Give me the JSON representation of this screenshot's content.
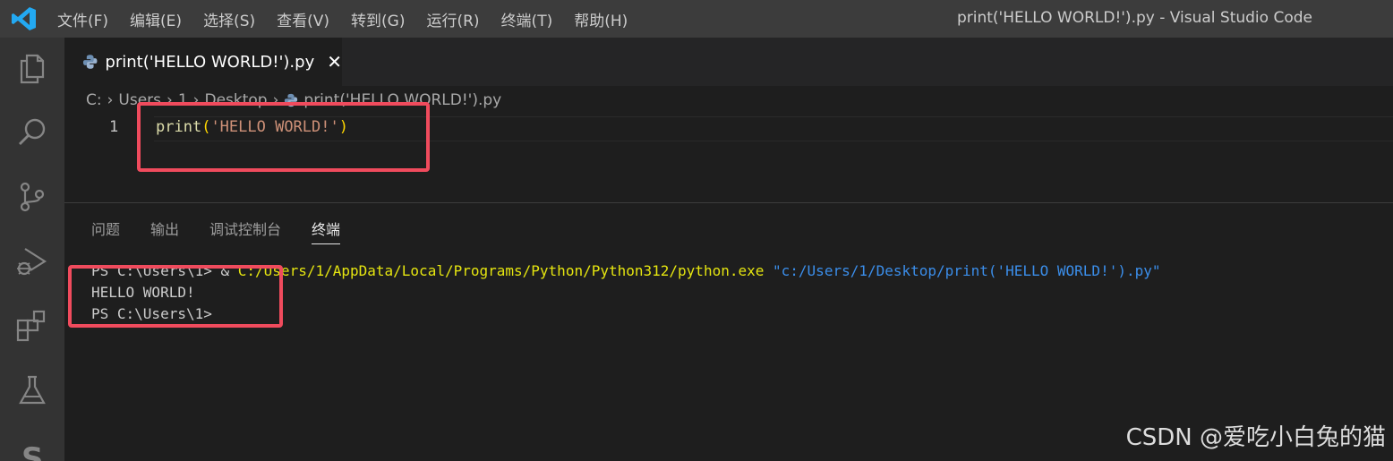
{
  "titlebar": {
    "menu": [
      "文件(F)",
      "编辑(E)",
      "选择(S)",
      "查看(V)",
      "转到(G)",
      "运行(R)",
      "终端(T)",
      "帮助(H)"
    ],
    "window_title": "print('HELLO WORLD!').py - Visual Studio Code"
  },
  "activity_bar": {
    "icons": [
      "explorer-icon",
      "search-icon",
      "source-control-icon",
      "run-debug-icon",
      "extensions-icon",
      "testing-icon",
      "account-icon"
    ]
  },
  "tab": {
    "label": "print('HELLO WORLD!').py",
    "close": "✕"
  },
  "breadcrumb": {
    "items": [
      "C:",
      "Users",
      "1",
      "Desktop",
      "print('HELLO WORLD!').py"
    ]
  },
  "editor": {
    "line_number": "1",
    "code": {
      "fn": "print",
      "open": "(",
      "str": "'HELLO WORLD!'",
      "close": ")"
    }
  },
  "panel": {
    "tabs": [
      "问题",
      "输出",
      "调试控制台",
      "终端"
    ],
    "active_tab": "终端"
  },
  "terminal": {
    "cmd_prompt": "PS C:\\Users\\1> ",
    "cmd_amp": "& ",
    "cmd_exe": "C:/Users/1/AppData/Local/Programs/Python/Python312/python.exe",
    "cmd_arg": "\"c:/Users/1/Desktop/print('HELLO WORLD!').py\"",
    "output": "HELLO WORLD!",
    "prompt": "PS C:\\Users\\1>"
  },
  "watermark": "CSDN @爱吃小白兔的猫",
  "colors": {
    "highlight": "#f04b5d",
    "string": "#ce9178",
    "function": "#dcdcaa",
    "terminal_yellow": "#e5e510",
    "terminal_blue": "#3b8eea"
  }
}
